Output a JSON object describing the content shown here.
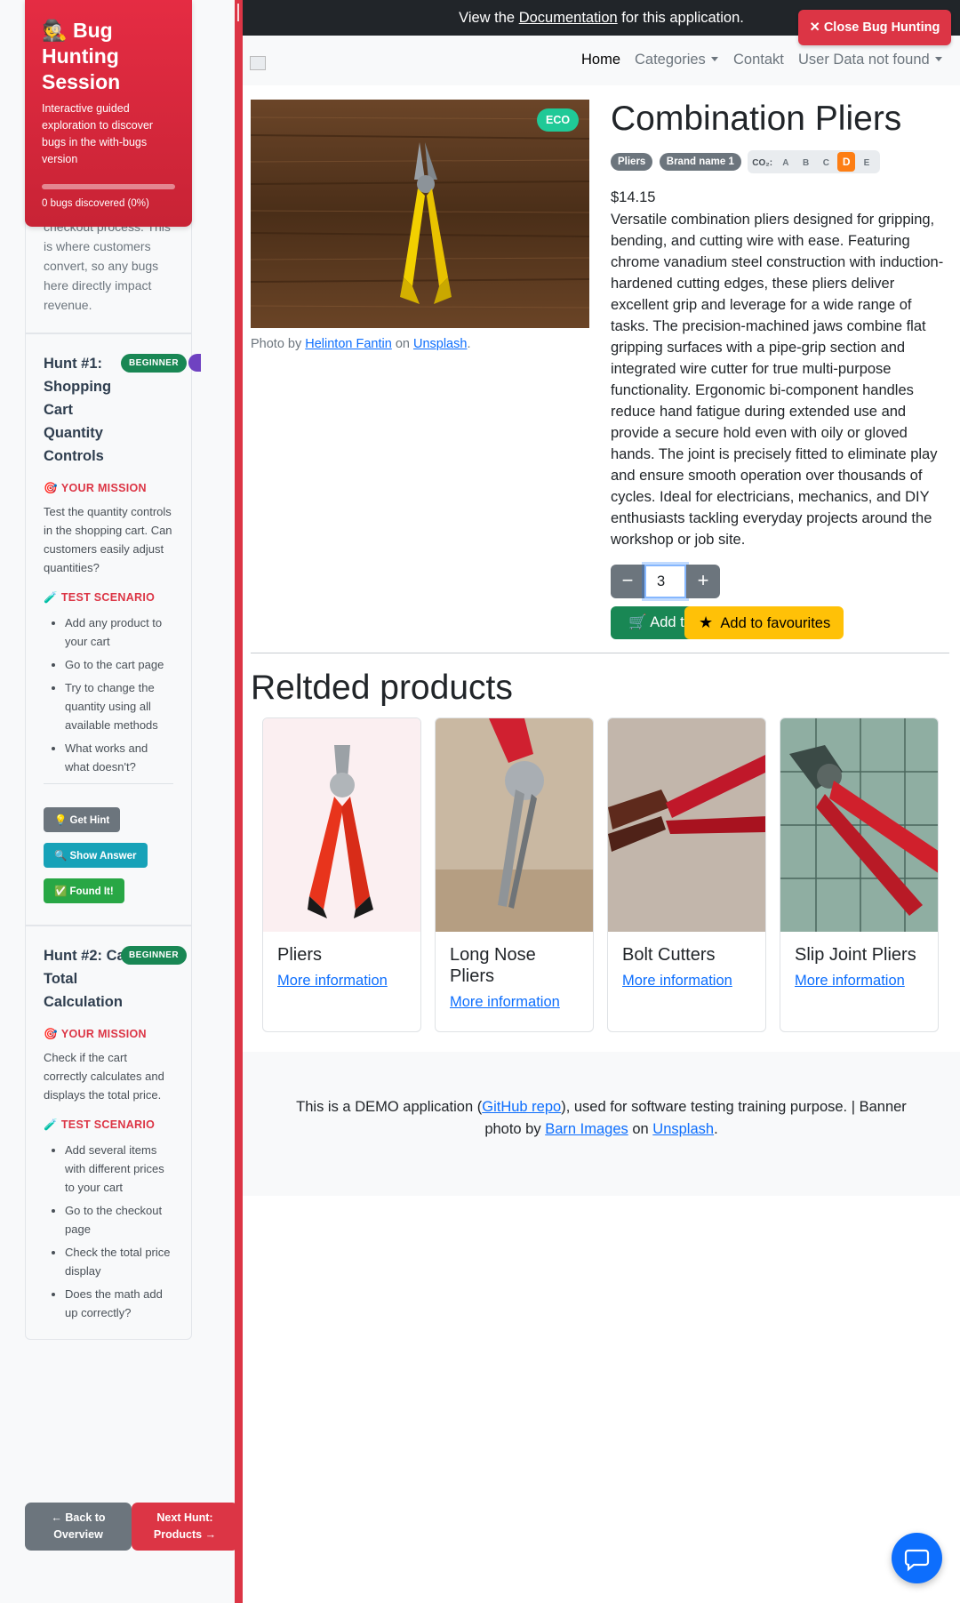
{
  "session": {
    "title": "🕵️ Bug Hunting Session",
    "description": "Interactive guided exploration to discover bugs in the with-bugs version",
    "progress_fraction": 0.0,
    "count_text": "0 bugs discovered (0%)"
  },
  "intro_tail": "checkout process. This is where customers convert, so any bugs here directly impact revenue.",
  "hunts": [
    {
      "title": "Hunt #1: Shopping Cart Quantity Controls",
      "badge": "BEGINNER",
      "mission_label": "YOUR MISSION",
      "mission_text": "Test the quantity controls in the shopping cart. Can customers easily adjust quantities?",
      "scenario_label": "TEST SCENARIO",
      "steps": [
        "Add any product to your cart",
        "Go to the cart page",
        "Try to change the quantity using all available methods",
        "What works and what doesn't?"
      ],
      "hint_label": "💡 Get Hint",
      "answer_label": "🔍 Show Answer",
      "found_label": "✅ Found It!"
    },
    {
      "title": "Hunt #2: Cart Total Calculation",
      "badge": "BEGINNER",
      "mission_label": "YOUR MISSION",
      "mission_text": "Check if the cart correctly calculates and displays the total price.",
      "scenario_label": "TEST SCENARIO",
      "steps": [
        "Add several items with different prices to your cart",
        "Go to the checkout page",
        "Check the total price display",
        "Does the math add up correctly?"
      ]
    }
  ],
  "nav": {
    "back_label": "← Back to Overview",
    "next_label": "Next Hunt: Products →"
  },
  "topbar": {
    "prefix": "View the ",
    "link": "Documentation",
    "suffix": " for this application.",
    "close_label": "✕ Close Bug Hunting"
  },
  "navbar": {
    "home": "Home",
    "categories": "Categories",
    "contact": "Contakt",
    "user": "User Data not found"
  },
  "product": {
    "eco_badge": "ECO",
    "credit_prefix": "Photo by ",
    "credit_author": "Helinton Fantin",
    "credit_mid": " on ",
    "credit_site": "Unsplash",
    "credit_end": ".",
    "title": "Combination Pliers",
    "category_tag": "Pliers",
    "brand_tag": "Brand name 1",
    "co2_label": "CO₂:",
    "co2_grades": [
      "A",
      "B",
      "C",
      "D",
      "E"
    ],
    "co2_active": "D",
    "price": "$14.15",
    "description": "Versatile combination pliers designed for gripping, bending, and cutting wire with ease. Featuring chrome vanadium steel construction with induction-hardened cutting edges, these pliers deliver excellent grip and leverage for a wide range of tasks. The precision-machined jaws combine flat gripping surfaces with a pipe-grip section and integrated wire cutter for true multi-purpose functionality. Ergonomic bi-component handles reduce hand fatigue during extended use and provide a secure hold even with oily or gloved hands. The joint is precisely fitted to eliminate play and ensure smooth operation over thousands of cycles. Ideal for electricians, mechanics, and DIY enthusiasts tackling everyday projects around the workshop or job site.",
    "quantity": "3",
    "minus": "−",
    "plus": "+",
    "cart_label": "Add to cart",
    "fav_label": "Add to favourites"
  },
  "related": {
    "title": "Reltded products",
    "items": [
      {
        "name": "Pliers",
        "link": "More information"
      },
      {
        "name": "Long Nose Pliers",
        "link": "More information"
      },
      {
        "name": "Bolt Cutters",
        "link": "More information"
      },
      {
        "name": "Slip Joint Pliers",
        "link": "More information"
      }
    ]
  },
  "footer": {
    "p1": "This is a DEMO application (",
    "repo": "GitHub repo",
    "p2": "), used for software testing training purpose. | Banner photo by ",
    "author": "Barn Images",
    "p3": " on ",
    "site": "Unsplash",
    "p4": "."
  },
  "colors": {
    "accent_red": "#dc3545",
    "eco_green": "#20c997",
    "cart_green": "#198754",
    "favourite_yellow": "#ffc107",
    "co2_active": "#fd7e14"
  }
}
